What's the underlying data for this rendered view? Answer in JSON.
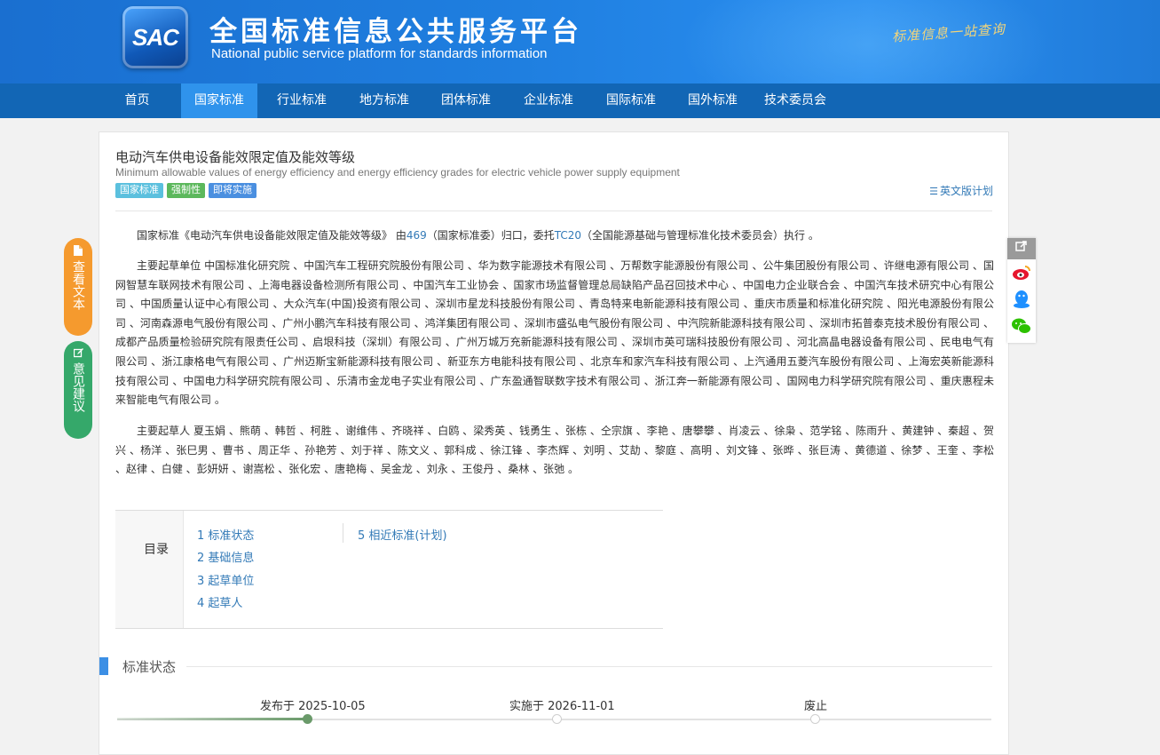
{
  "header": {
    "logo_text": "SAC",
    "title": "全国标准信息公共服务平台",
    "subtitle": "National public service platform  for standards information",
    "slogan": "标准信息一站查询"
  },
  "nav": {
    "items": [
      "首页",
      "国家标准",
      "行业标准",
      "地方标准",
      "团体标准",
      "企业标准",
      "国际标准",
      "国外标准",
      "技术委员会"
    ],
    "active": "国家标准"
  },
  "standard": {
    "title": "电动汽车供电设备能效限定值及能效等级",
    "title_en": "Minimum allowable values of energy efficiency and energy efficiency grades for electric vehicle power supply equipment",
    "tags": [
      "国家标准",
      "强制性",
      "即将实施"
    ],
    "english_plan": "英文版计划",
    "summary": {
      "prefix": "国家标准《电动汽车供电设备能效限定值及能效等级》 由",
      "org_link": "469",
      "mid": "（国家标准委）归口，委托",
      "tc_link": "TC20",
      "suffix": "（全国能源基础与管理标准化技术委员会）执行 。"
    },
    "drafting_units_label": "主要起草单位",
    "drafting_units": "中国标准化研究院 、中国汽车工程研究院股份有限公司 、华为数字能源技术有限公司 、万帮数字能源股份有限公司 、公牛集团股份有限公司 、许继电源有限公司 、国网智慧车联网技术有限公司 、上海电器设备检测所有限公司 、中国汽车工业协会 、国家市场监督管理总局缺陷产品召回技术中心 、中国电力企业联合会 、中国汽车技术研究中心有限公司 、中国质量认证中心有限公司 、大众汽车(中国)投资有限公司 、深圳市星龙科技股份有限公司 、青岛特来电新能源科技有限公司 、重庆市质量和标准化研究院 、阳光电源股份有限公司 、河南森源电气股份有限公司 、广州小鹏汽车科技有限公司 、鸿洋集团有限公司 、深圳市盛弘电气股份有限公司 、中汽院新能源科技有限公司 、深圳市拓普泰克技术股份有限公司 、成都产品质量检验研究院有限责任公司 、启垠科技（深圳）有限公司 、广州万城万充新能源科技有限公司 、深圳市英可瑞科技股份有限公司 、河北高晶电器设备有限公司 、民电电气有限公司 、浙江康格电气有限公司 、广州迈斯宝新能源科技有限公司 、新亚东方电能科技有限公司 、北京车和家汽车科技有限公司 、上汽通用五菱汽车股份有限公司 、上海宏英新能源科技有限公司 、中国电力科学研究院有限公司 、乐清市金龙电子实业有限公司 、广东盈通智联数字技术有限公司 、浙江奔一新能源有限公司 、国网电力科学研究院有限公司 、重庆惠程未来智能电气有限公司 。",
    "drafters_label": "主要起草人",
    "drafters": "夏玉娟 、熊萌 、韩哲 、柯胜 、谢维伟 、齐晓祥 、白鸥 、梁秀英 、钱勇生 、张栋 、仝宗旗 、李艳 、唐攀攀 、肖凌云 、徐枭 、范学铭 、陈雨升 、黄建钟 、秦超 、贺兴 、杨洋 、张巳男 、曹书 、周正华 、孙艳芳 、刘于祥 、陈文义 、郭科成 、徐江锋 、李杰辉 、刘明 、艾劼 、黎庭 、高明 、刘文锋 、张晔 、张巨涛 、黄德道 、徐梦 、王奎 、李松 、赵律 、白健 、彭妍妍 、谢嵩松 、张化宏 、唐艳梅 、吴金龙 、刘永 、王俊丹 、桑林 、张弛 。"
  },
  "toc": {
    "label": "目录",
    "items": [
      "1  标准状态",
      "2  基础信息",
      "3  起草单位",
      "4  起草人",
      "5  相近标准(计划)"
    ]
  },
  "status": {
    "section_title": "标准状态",
    "published": "发布于 2025-10-05",
    "effective": "实施于 2026-11-01",
    "abolished": "废止"
  },
  "float_buttons": {
    "view_text": "查看文本",
    "feedback": "意见建议"
  },
  "colors": {
    "header": "#1a6fd0",
    "nav": "#1266b5",
    "nav_active": "#2f93ec",
    "link": "#337ab7",
    "orange": "#f59a2e",
    "green": "#35a86a"
  }
}
